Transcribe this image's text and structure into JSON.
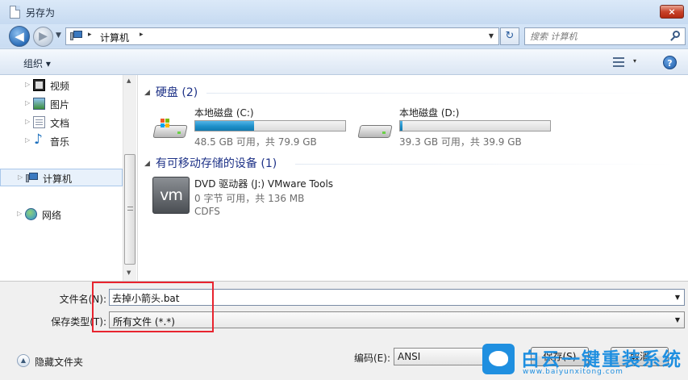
{
  "window": {
    "title": "另存为",
    "close_glyph": "×"
  },
  "address_bar": {
    "back_glyph": "◀",
    "forward_glyph": "▶",
    "separator": "▸",
    "path": "计算机",
    "refresh_icon": "refresh-arrows-icon",
    "search_placeholder": "搜索 计算机"
  },
  "toolbar": {
    "organize_label": "组织 ▾",
    "views_arrow": "▾",
    "help_glyph": "?"
  },
  "sidebar": {
    "items": [
      {
        "label": "视频",
        "icon": "video-library-icon"
      },
      {
        "label": "图片",
        "icon": "pictures-library-icon"
      },
      {
        "label": "文档",
        "icon": "documents-library-icon"
      },
      {
        "label": "音乐",
        "icon": "music-library-icon"
      },
      {
        "label": "计算机",
        "icon": "computer-icon",
        "selected": true
      },
      {
        "label": "网络",
        "icon": "network-icon"
      }
    ]
  },
  "groups": {
    "hard_disks": {
      "header": "硬盘 (2)",
      "drives": [
        {
          "name": "本地磁盘 (C:)",
          "info": "48.5 GB 可用，共 79.9 GB",
          "used_fraction": 0.393,
          "icon": "system-drive-icon"
        },
        {
          "name": "本地磁盘 (D:)",
          "info": "39.3 GB 可用，共 39.9 GB",
          "used_fraction": 0.015,
          "icon": "hard-drive-icon"
        }
      ]
    },
    "removable": {
      "header": "有可移动存储的设备 (1)",
      "device": {
        "name": "DVD 驱动器 (J:) VMware Tools",
        "info": "0 字节 可用，共 136 MB",
        "fs": "CDFS",
        "logo": "vm"
      }
    }
  },
  "save_form": {
    "filename_label": "文件名(N):",
    "filename_value": "去掉小箭头.bat",
    "filetype_label": "保存类型(T):",
    "filetype_value": "所有文件  (*.*)",
    "hide_folders_label": "隐藏文件夹",
    "encoding_label": "编码(E):",
    "encoding_value": "ANSI",
    "save_button": "保存(S)",
    "cancel_button": "取消"
  },
  "watermark": {
    "text": "白云一键重装系统",
    "url": "www.baiyunxitong.com"
  },
  "colors": {
    "accent": "#1f8fe0",
    "highlight_box": "#e8242f",
    "progress": "#1e8fc9"
  }
}
